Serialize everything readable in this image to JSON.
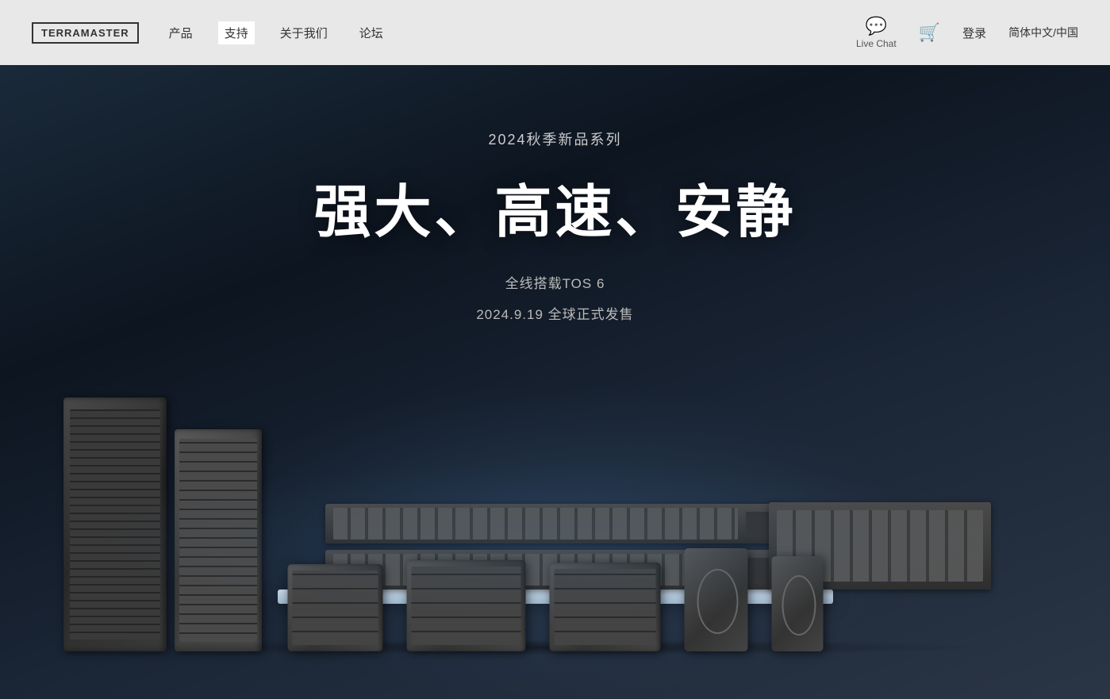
{
  "navbar": {
    "logo": "TERRAMASTER",
    "nav_items": [
      {
        "label": "产品",
        "active": false
      },
      {
        "label": "支持",
        "active": true
      },
      {
        "label": "关于我们",
        "active": false
      },
      {
        "label": "论坛",
        "active": false
      }
    ],
    "live_chat_label": "Live Chat",
    "cart_icon_label": "cart-icon",
    "login_label": "登录",
    "language_label": "简体中文/中国"
  },
  "hero": {
    "series_label": "2024秋季新品系列",
    "title": "强大、高速、安静",
    "tos_label": "全线搭载TOS 6",
    "release_date": "2024.9.19 全球正式发售"
  }
}
